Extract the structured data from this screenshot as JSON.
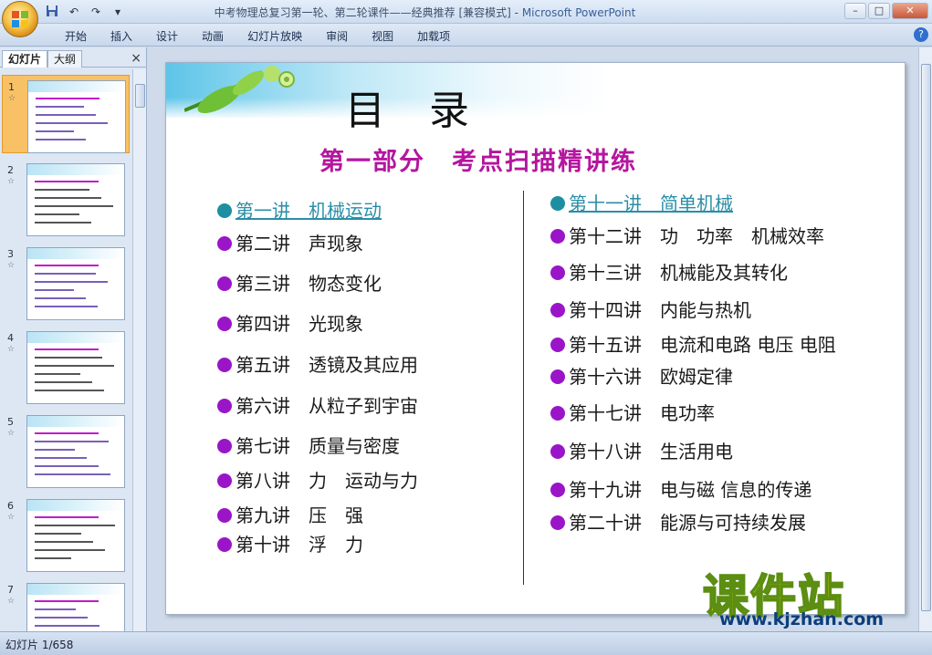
{
  "window": {
    "title": "中考物理总复习第一轮、第二轮课件——经典推荐 [兼容模式] - ",
    "app_name": "Microsoft PowerPoint"
  },
  "quick_access": {
    "save_icon": "save-icon",
    "undo_icon": "undo-icon",
    "redo_icon": "redo-icon",
    "more_icon": "dropdown-icon"
  },
  "ribbon": {
    "tabs": [
      "开始",
      "插入",
      "设计",
      "动画",
      "幻灯片放映",
      "审阅",
      "视图",
      "加载项"
    ]
  },
  "left_pane": {
    "tab_slides": "幻灯片",
    "tab_outline": "大纲",
    "close": "×",
    "thumbnails": [
      {
        "num": "1",
        "selected": true
      },
      {
        "num": "2",
        "selected": false
      },
      {
        "num": "3",
        "selected": false
      },
      {
        "num": "4",
        "selected": false
      },
      {
        "num": "5",
        "selected": false
      },
      {
        "num": "6",
        "selected": false
      },
      {
        "num": "7",
        "selected": false
      }
    ],
    "star": "☆"
  },
  "slide": {
    "title": "目录",
    "subtitle": "第一部分　考点扫描精讲练",
    "left_items": [
      "第一讲　机械运动",
      "第二讲　声现象",
      "第三讲　物态变化",
      "第四讲　光现象",
      "第五讲　透镜及其应用",
      "第六讲　从粒子到宇宙",
      "第七讲　质量与密度",
      "第八讲　力　运动与力",
      "第九讲　压　强",
      "第十讲　浮　力"
    ],
    "right_items": [
      "第十一讲　简单机械",
      "第十二讲　功　功率　机械效率",
      "第十三讲　机械能及其转化",
      "第十四讲　内能与热机",
      "第十五讲　电流和电路 电压 电阻",
      "第十六讲　欧姆定律",
      "第十七讲　电功率",
      "第十八讲　生活用电",
      "第十九讲　电与磁 信息的传递",
      "第二十讲　能源与可持续发展"
    ],
    "colors": {
      "bullet": "#9a15c8",
      "link": "#2a8ea7",
      "subtitle": "#b4169e"
    }
  },
  "watermark": {
    "cn": "课件站",
    "url": "www.kjzhan.com"
  },
  "status": {
    "slide_counter": "幻灯片 1/658"
  }
}
